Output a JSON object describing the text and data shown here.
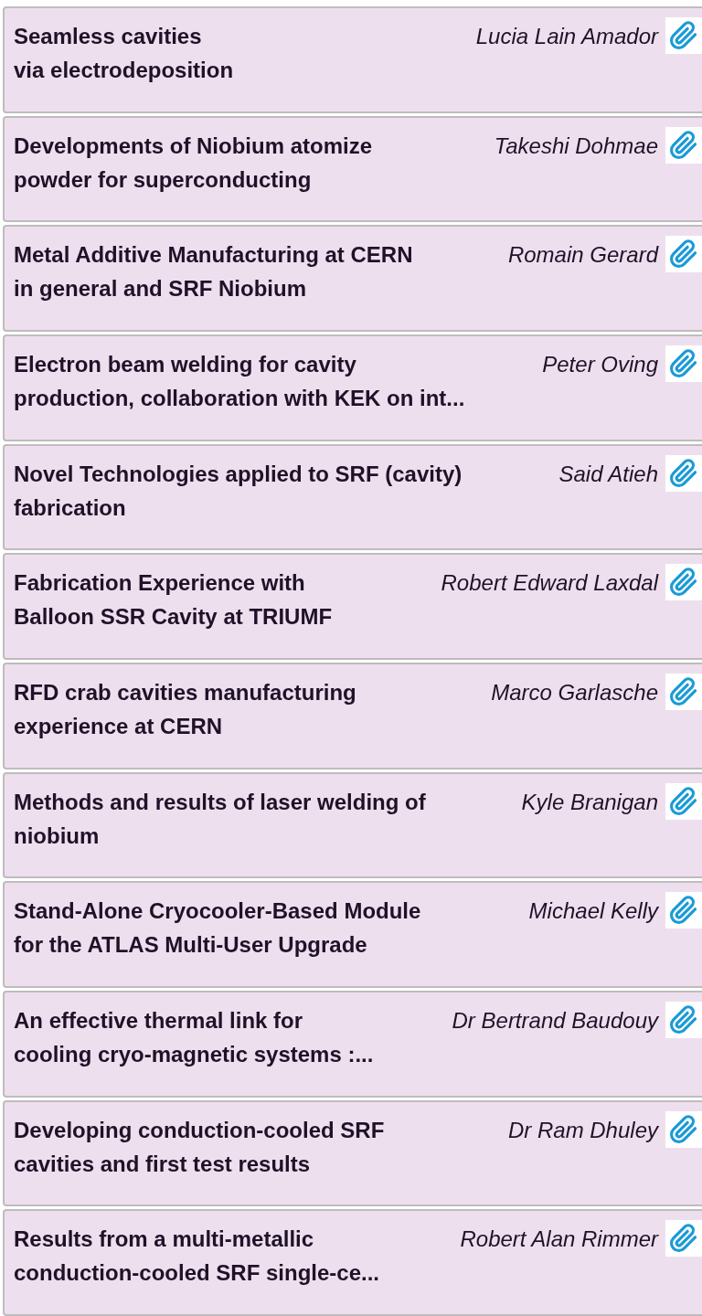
{
  "talks": [
    {
      "title": "Seamless cavities\nvia electrodeposition",
      "speaker": "Lucia Lain Amador"
    },
    {
      "title": "Developments of Niobium atomize\npowder for superconducting",
      "speaker": "Takeshi Dohmae"
    },
    {
      "title": "Metal Additive Manufacturing at CERN\nin general and SRF Niobium",
      "speaker": "Romain Gerard"
    },
    {
      "title": "Electron beam welding for cavity\nproduction, collaboration with KEK on int...",
      "speaker": "Peter Oving"
    },
    {
      "title": "Novel Technologies applied to SRF (cavity)\nfabrication",
      "speaker": "Said Atieh"
    },
    {
      "title": "Fabrication Experience with\nBalloon SSR Cavity at TRIUMF",
      "speaker": "Robert Edward Laxdal"
    },
    {
      "title": "RFD crab cavities manufacturing\nexperience at CERN",
      "speaker": "Marco Garlasche"
    },
    {
      "title": "Methods and results of laser welding of\nniobium",
      "speaker": "Kyle Branigan"
    },
    {
      "title": "Stand-Alone Cryocooler-Based Module\nfor the ATLAS Multi-User Upgrade",
      "speaker": "Michael Kelly"
    },
    {
      "title": "An effective thermal link for\ncooling cryo-magnetic systems :...",
      "speaker": "Dr Bertrand Baudouy"
    },
    {
      "title": "Developing conduction-cooled SRF\ncavities and first test results",
      "speaker": "Dr Ram Dhuley"
    },
    {
      "title": "Results from a multi-metallic\nconduction-cooled SRF single-ce...",
      "speaker": "Robert Alan Rimmer"
    }
  ]
}
